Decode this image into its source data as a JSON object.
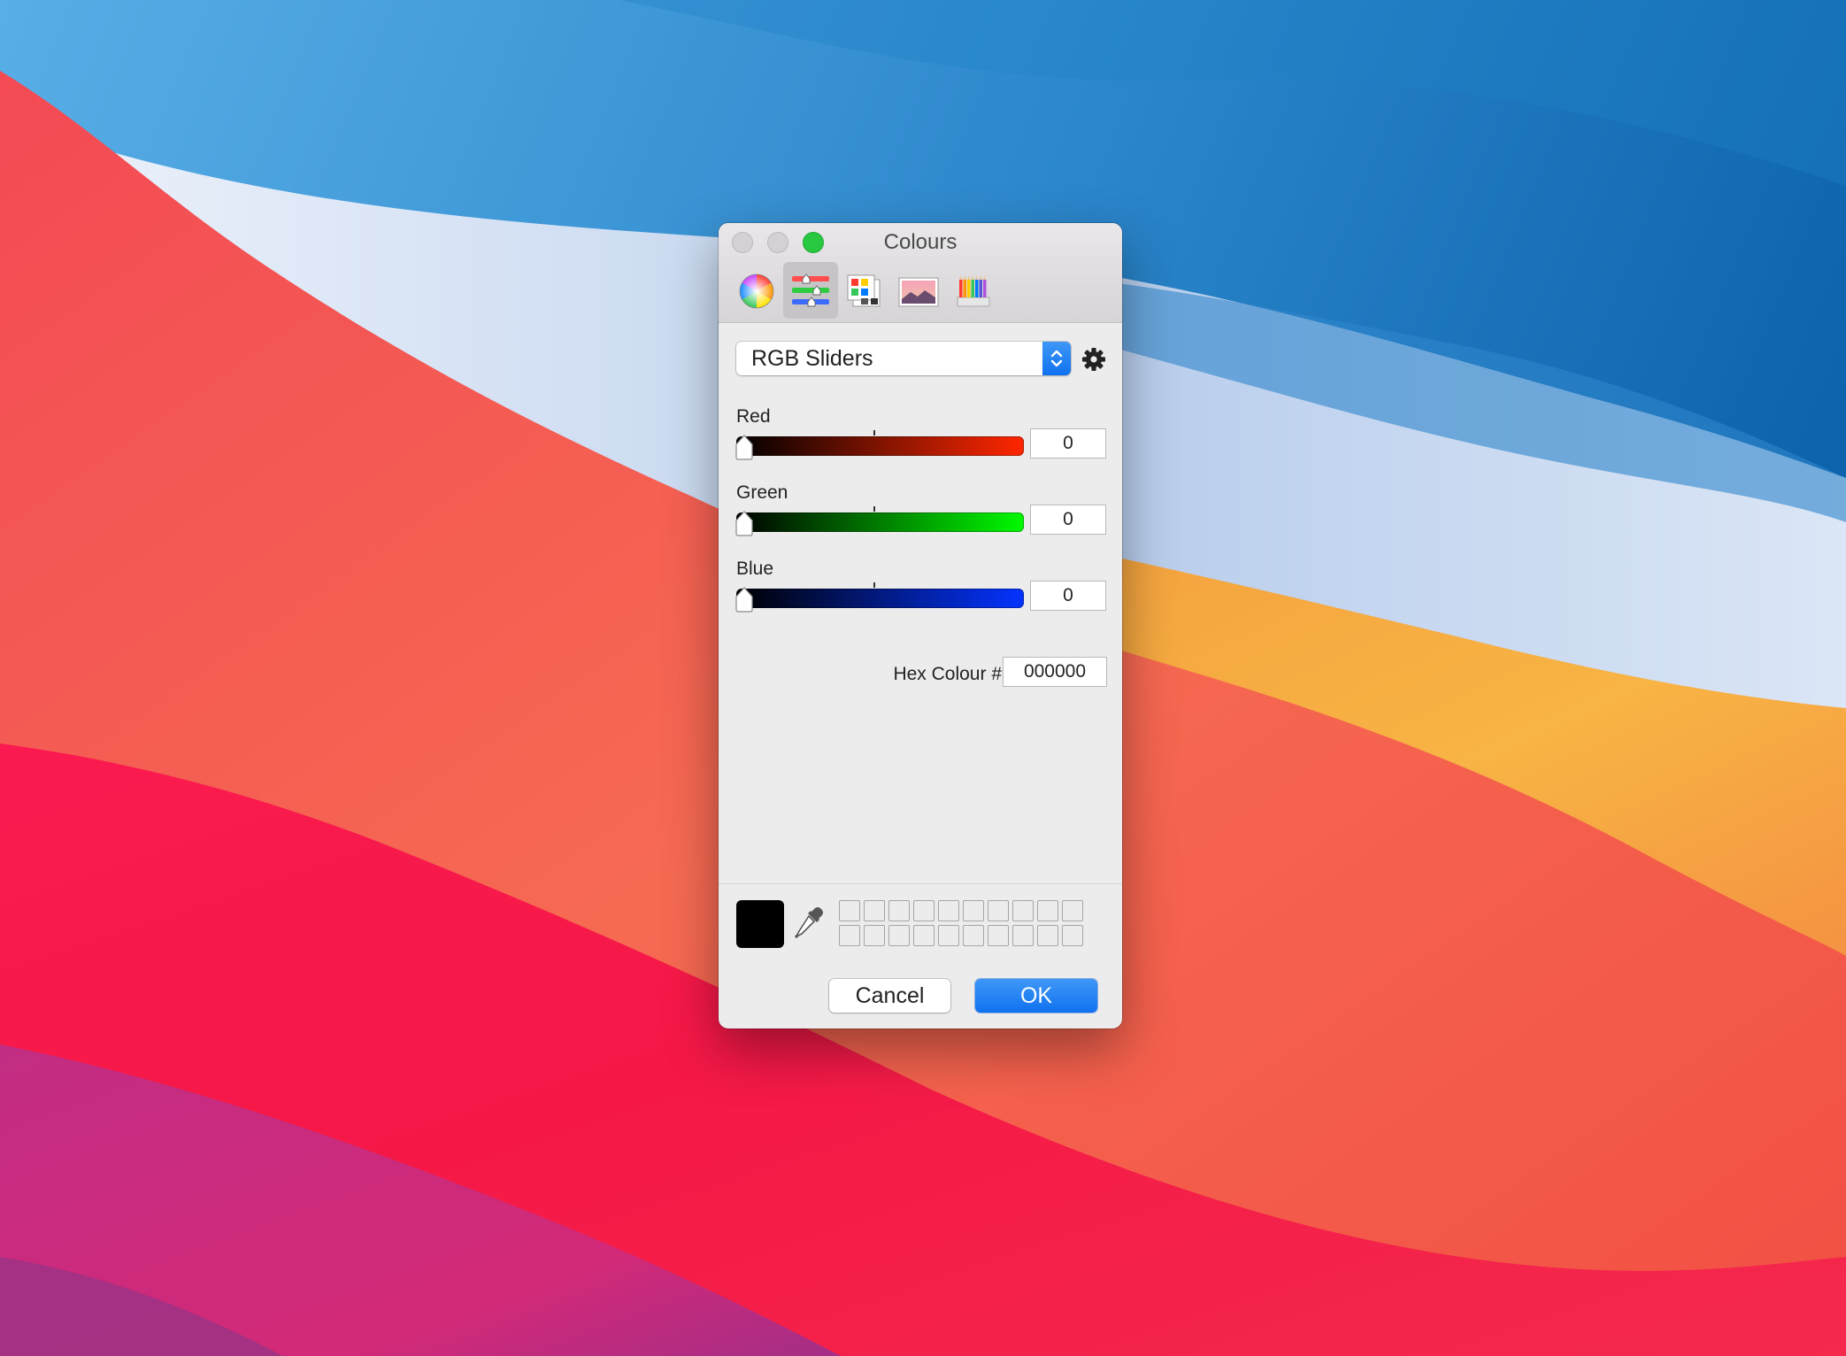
{
  "window": {
    "title": "Colours",
    "toolbar_tabs": [
      "colour-wheel",
      "colour-sliders",
      "colour-palettes",
      "image-palettes",
      "pencils"
    ],
    "active_tab": "colour-sliders"
  },
  "mode_popup": {
    "selected": "RGB Sliders"
  },
  "sliders": [
    {
      "label": "Red",
      "value": "0",
      "fraction": 0,
      "color": "#ff2600"
    },
    {
      "label": "Green",
      "value": "0",
      "fraction": 0,
      "color": "#00f900"
    },
    {
      "label": "Blue",
      "value": "0",
      "fraction": 0,
      "color": "#0433ff"
    }
  ],
  "hex": {
    "label": "Hex Colour #",
    "value": "000000"
  },
  "current_colour": "#000000",
  "buttons": {
    "cancel": "Cancel",
    "ok": "OK"
  },
  "colors": {
    "accent": "#1a7cf2",
    "zoom_button": "#28c840",
    "window_bg": "#ececec"
  }
}
